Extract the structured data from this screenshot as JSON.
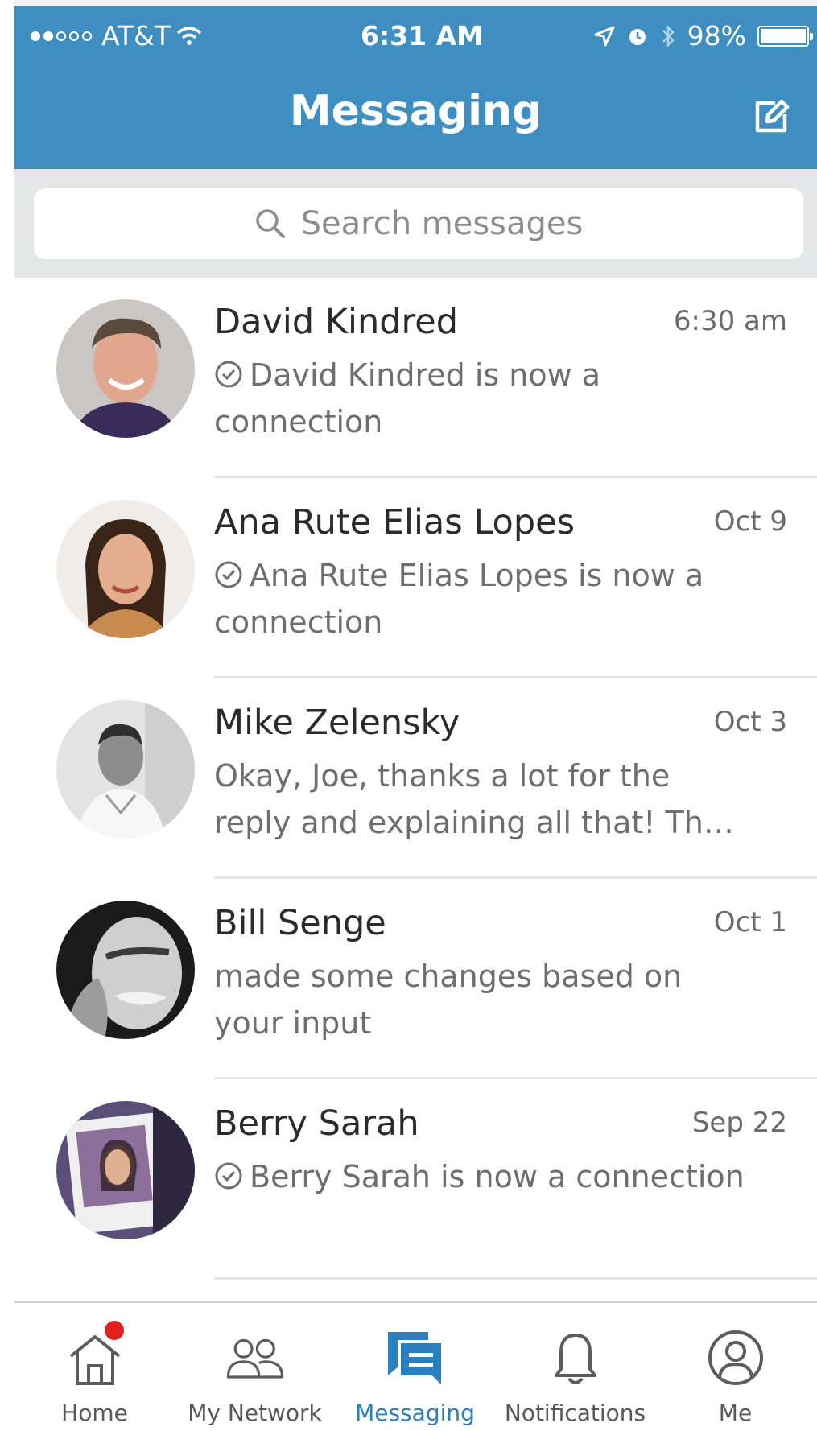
{
  "status_bar": {
    "carrier": "AT&T",
    "time": "6:31 AM",
    "battery": "98%"
  },
  "header": {
    "title": "Messaging",
    "compose_icon": "compose-icon"
  },
  "search": {
    "placeholder": "Search messages",
    "icon": "search-icon"
  },
  "conversations": [
    {
      "name": "David Kindred",
      "date": "6:30 am",
      "preview": "David Kindred is now a connection",
      "connection_check": true
    },
    {
      "name": "Ana Rute Elias Lopes",
      "date": "Oct 9",
      "preview": "Ana Rute Elias Lopes is now a connection",
      "connection_check": true
    },
    {
      "name": "Mike Zelensky",
      "date": "Oct 3",
      "preview": "Okay, Joe, thanks a lot for the reply and explaining all that! Th…",
      "connection_check": false
    },
    {
      "name": "Bill Senge",
      "date": "Oct 1",
      "preview": "made some changes based on your input",
      "connection_check": false
    },
    {
      "name": "Berry Sarah",
      "date": "Sep 22",
      "preview": "Berry Sarah is now a connection",
      "connection_check": true
    }
  ],
  "tabbar": {
    "tabs": [
      {
        "label": "Home",
        "icon": "home-icon",
        "badge": true
      },
      {
        "label": "My Network",
        "icon": "network-icon"
      },
      {
        "label": "Messaging",
        "icon": "messaging-icon",
        "active": true
      },
      {
        "label": "Notifications",
        "icon": "bell-icon"
      },
      {
        "label": "Me",
        "icon": "profile-icon"
      }
    ]
  },
  "colors": {
    "header": "#3f8ec1",
    "active_tab": "#2a7fbf",
    "badge": "#e0211d"
  }
}
